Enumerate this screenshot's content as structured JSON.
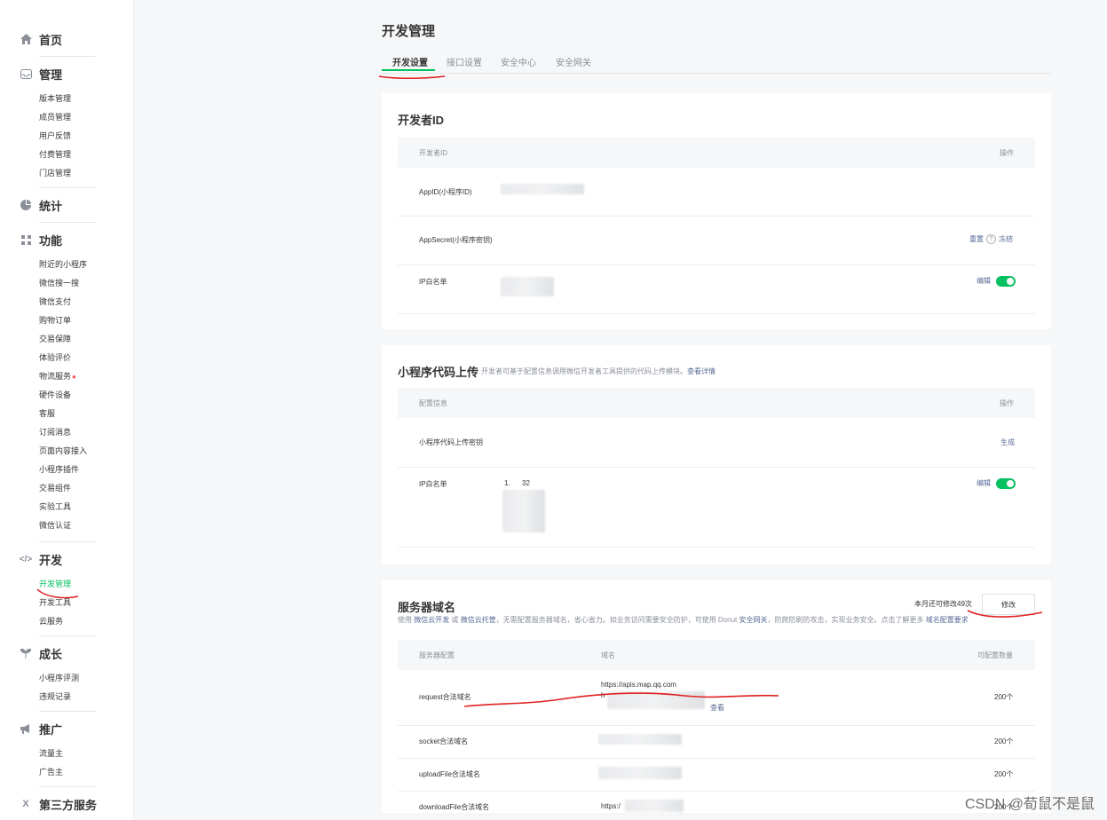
{
  "sidebar": {
    "home": "首页",
    "manage": {
      "label": "管理",
      "items": [
        "版本管理",
        "成员管理",
        "用户反馈",
        "付费管理",
        "门店管理"
      ]
    },
    "stats": "统计",
    "features": {
      "label": "功能",
      "items": [
        "附近的小程序",
        "微信搜一搜",
        "微信支付",
        "购物订单",
        "交易保障",
        "体验评价",
        "物流服务",
        "硬件设备",
        "客服",
        "订阅消息",
        "页面内容接入",
        "小程序插件",
        "交易组件",
        "实验工具",
        "微信认证"
      ]
    },
    "dev": {
      "label": "开发",
      "items": [
        "开发管理",
        "开发工具",
        "云服务"
      ]
    },
    "growth": {
      "label": "成长",
      "items": [
        "小程序评测",
        "违规记录"
      ]
    },
    "promo": {
      "label": "推广",
      "items": [
        "流量主",
        "广告主"
      ]
    },
    "third": "第三方服务"
  },
  "page": {
    "title": "开发管理",
    "tabs": [
      "开发设置",
      "接口设置",
      "安全中心",
      "安全网关"
    ]
  },
  "dev_id_card": {
    "title": "开发者ID",
    "header": {
      "col1": "开发者ID",
      "col2": "操作"
    },
    "rows": [
      {
        "label": "AppID(小程序ID)"
      },
      {
        "label": "AppSecret(小程序密钥)",
        "action_reset": "重置",
        "action_freeze": "冻结"
      },
      {
        "label": "IP白名单",
        "action": "编辑"
      }
    ]
  },
  "upload_card": {
    "title": "小程序代码上传",
    "desc": "开发者可基于配置信息调用微信开发者工具提供的代码上传模块。",
    "desc_link": "查看详情",
    "header": {
      "col1": "配置信息",
      "col2": "操作"
    },
    "rows": [
      {
        "label": "小程序代码上传密钥",
        "action": "生成"
      },
      {
        "label": "IP白名单",
        "value": "1.      32",
        "action": "编辑"
      }
    ]
  },
  "domain_card": {
    "title": "服务器域名",
    "remaining": "本月还可修改49次",
    "modify_btn": "修改",
    "desc_a": "使用",
    "desc_link1": "微信云开发",
    "desc_b": "或",
    "desc_link2": "微信云托管",
    "desc_c": "，无需配置服务器域名，省心省力。如业务访问需要安全防护，可使用 Donut",
    "desc_link3": "安全网关",
    "desc_d": "，防爬防刷防攻击，实现业务安全。点击了解更多",
    "desc_link4": "域名配置要求",
    "header": {
      "col1": "服务器配置",
      "col2": "域名",
      "col3": "可配置数量"
    },
    "rows": [
      {
        "label": "request合法域名",
        "domain": "https://apis.map.qq.com",
        "domain2": "h",
        "more": "查看",
        "count": "200个"
      },
      {
        "label": "socket合法域名",
        "count": "200个"
      },
      {
        "label": "uploadFile合法域名",
        "count": "200个"
      },
      {
        "label": "downloadFile合法域名",
        "domain": "https:/",
        "count": "200个"
      }
    ]
  },
  "watermark": "CSDN @荀鼠不是鼠"
}
